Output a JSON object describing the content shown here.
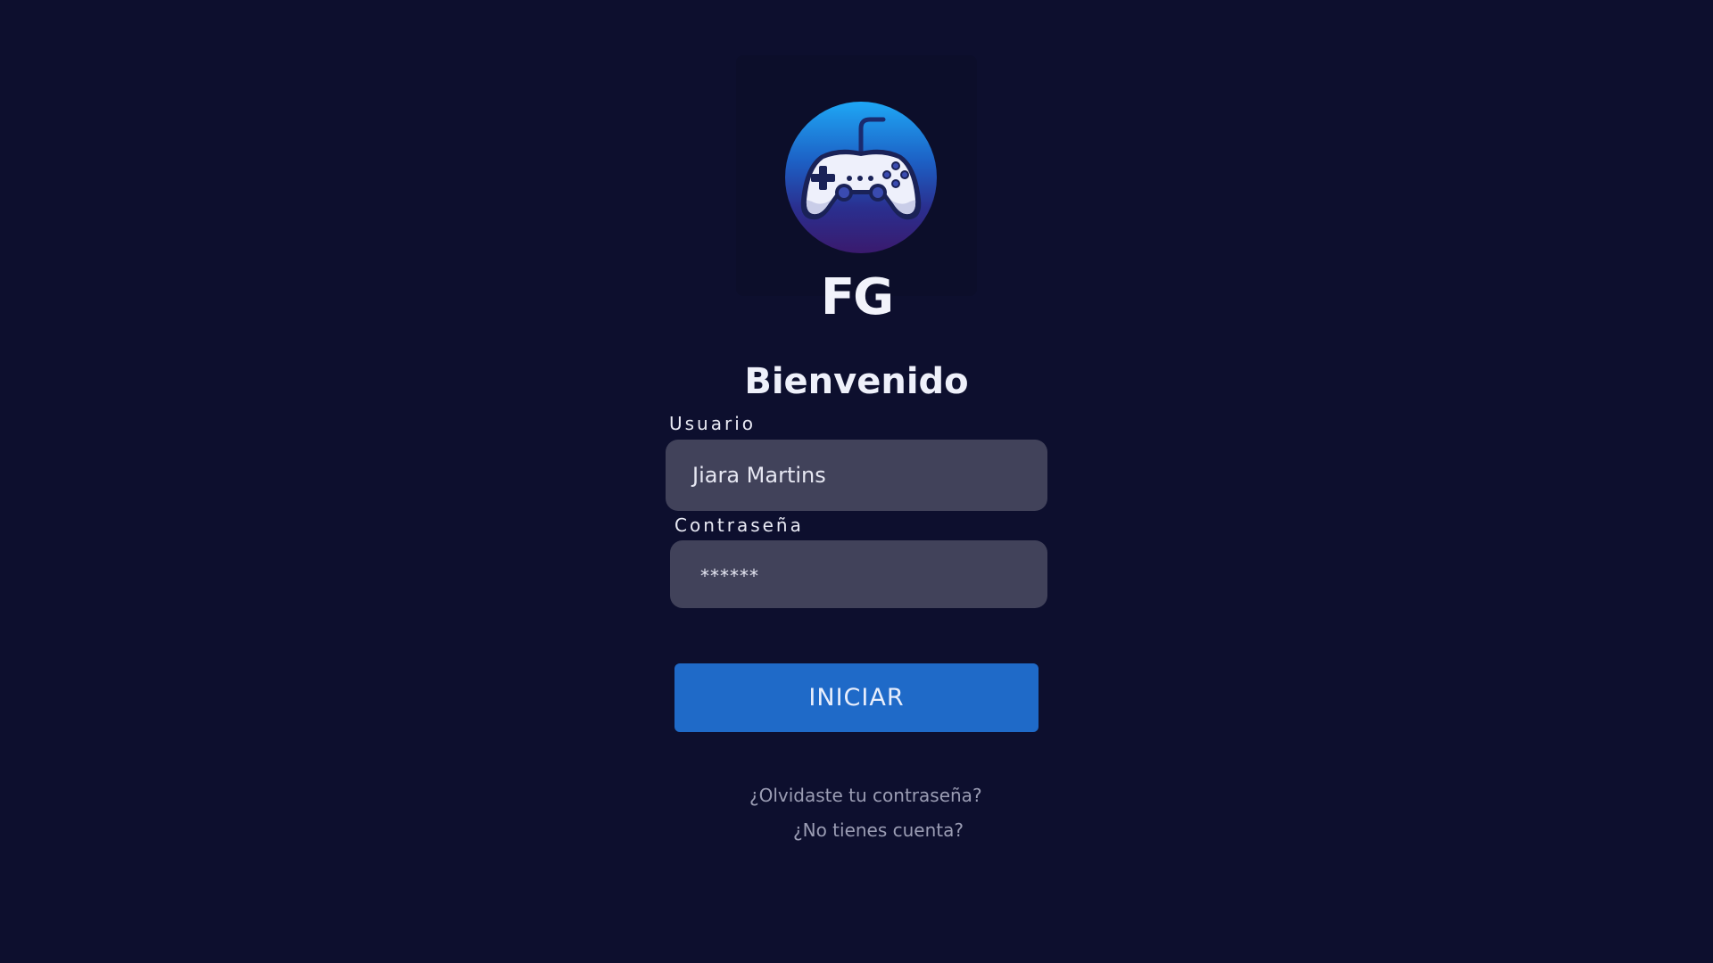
{
  "brand": {
    "logo_icon": "gamepad-icon",
    "name": "FG"
  },
  "login": {
    "title": "Bienvenido",
    "username_label": "Usuario",
    "username_value": "Jiara Martins",
    "password_label": "Contraseña",
    "password_value": "******",
    "submit_label": "INICIAR",
    "forgot_link": "¿Olvidaste tu contraseña?",
    "register_link": "¿No tienes cuenta?"
  },
  "colors": {
    "background": "#0d0f2e",
    "field": "#41425a",
    "button": "#1f6ac8",
    "link": "#9b9db4",
    "logo_gradient_top": "#1ea7f5",
    "logo_gradient_bottom": "#3a1a6e"
  }
}
